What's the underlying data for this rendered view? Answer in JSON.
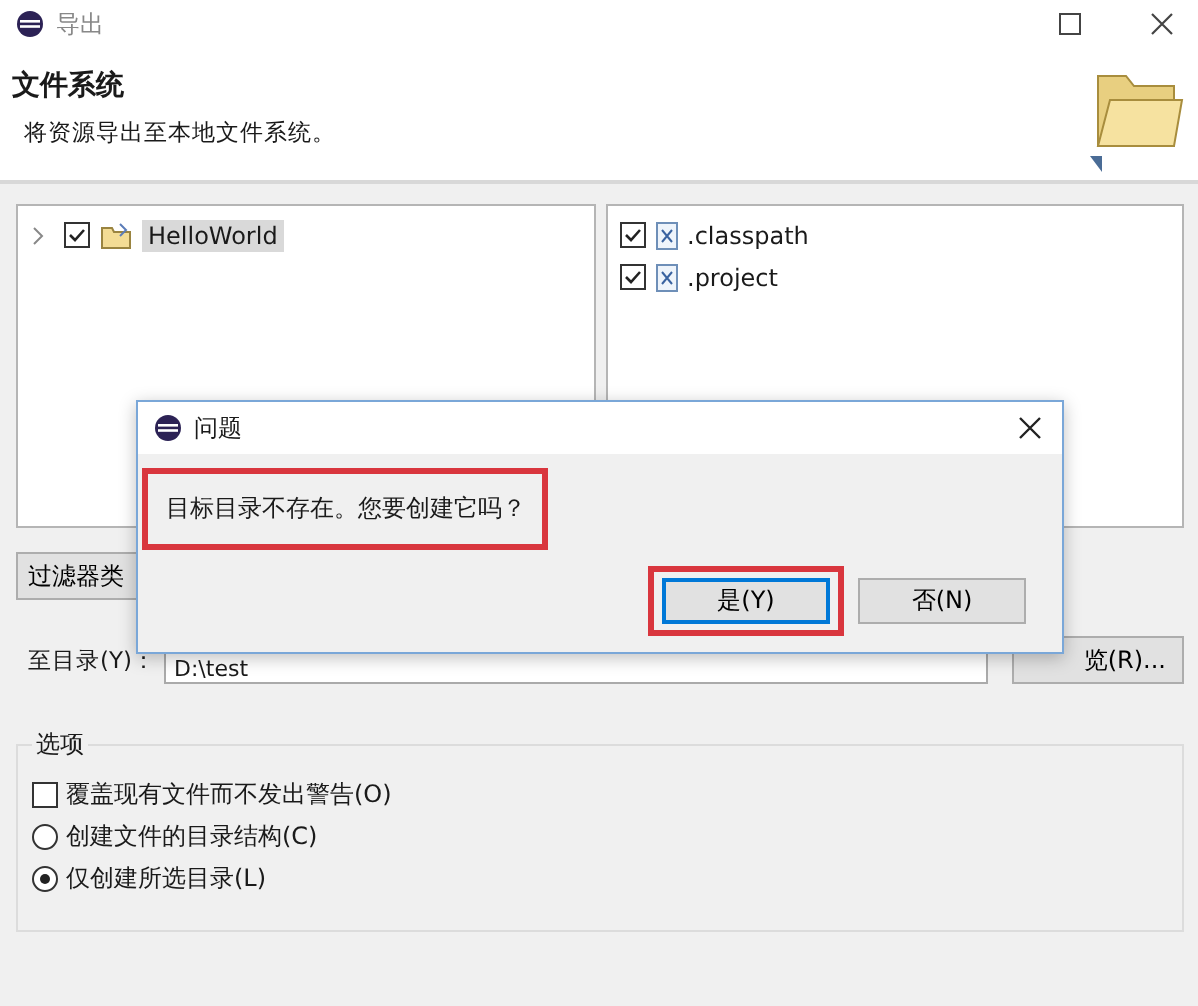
{
  "window": {
    "title": "导出"
  },
  "header": {
    "title": "文件系统",
    "description": "将资源导出至本地文件系统。"
  },
  "tree": [
    {
      "label": "HelloWorld",
      "checked": true,
      "expanded": false,
      "selected": true
    }
  ],
  "files": [
    {
      "label": ".classpath",
      "checked": true
    },
    {
      "label": ".project",
      "checked": true
    }
  ],
  "filter_button": {
    "label": "过滤器类"
  },
  "directory": {
    "label": "至目录(Y)：",
    "value": "D:\\test"
  },
  "browse_button": {
    "label": "览(R)..."
  },
  "options": {
    "title": "选项",
    "items": [
      {
        "kind": "checkbox",
        "label": "覆盖现有文件而不发出警告(O)",
        "checked": false
      },
      {
        "kind": "radio",
        "label": "创建文件的目录结构(C)",
        "checked": false
      },
      {
        "kind": "radio",
        "label": "仅创建所选目录(L)",
        "checked": true
      }
    ]
  },
  "dialog": {
    "title": "问题",
    "message": "目标目录不存在。您要创建它吗？",
    "message_highlighted": true,
    "buttons": [
      {
        "label": "是(Y)",
        "focused": true,
        "highlighted": true
      },
      {
        "label": "否(N)",
        "focused": false,
        "highlighted": false
      }
    ]
  }
}
